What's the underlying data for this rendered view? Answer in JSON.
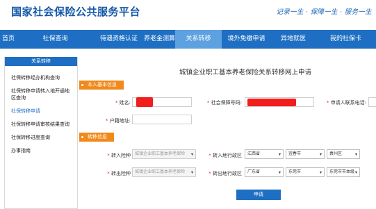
{
  "header": {
    "title": "国家社会保险公共服务平台",
    "slogan": "记录一生 · 保障一生 · 服务一生"
  },
  "nav": {
    "items": [
      {
        "label": "首页"
      },
      {
        "label": "社保查询"
      },
      {
        "label": "待遇资格认证"
      },
      {
        "label": "养老金测算"
      },
      {
        "label": "关系转移"
      },
      {
        "label": "境外免缴申请"
      },
      {
        "label": "异地就医"
      },
      {
        "label": "我的社保卡"
      }
    ],
    "active_index": 4
  },
  "sidebar": {
    "heading": "关系转移",
    "items": [
      {
        "label": "社保转移经办机构查询"
      },
      {
        "label": "社保转移申请转入地开通地区查询"
      },
      {
        "label": "社保转移申请"
      },
      {
        "label": "社保转移申请审核结果查询"
      },
      {
        "label": "社保转移进度查询"
      },
      {
        "label": "办事指南"
      }
    ],
    "active_index": 2
  },
  "form": {
    "title": "城镇企业职工基本养老保险关系转移网上申请",
    "section_basic": "本人基本信息",
    "name_label": "姓名:",
    "ss_number_label": "社会保障号码:",
    "phone_label": "申请人联系电话:",
    "household_label": "户籍地址:",
    "section_transfer": "转移信息",
    "transfer_in_type_label": "转入险种",
    "transfer_in_type_value": "城镇企业职工基本养老保险",
    "transfer_in_region_label": "转入地行政区",
    "transfer_in_province": "江西省",
    "transfer_in_city": "宜春市",
    "transfer_in_district": "袁州区",
    "transfer_out_type_label": "转出险种",
    "transfer_out_type_value": "城镇企业职工基本养老保险",
    "transfer_out_region_label": "转出地行政区",
    "transfer_out_province": "广东省",
    "transfer_out_city": "东莞市",
    "transfer_out_district": "东莞市市本级",
    "submit_label": "申请"
  },
  "colors": {
    "brand_blue": "#1e6fc3",
    "active_tab": "#5ea1e0",
    "section_orange": "#f08a1c",
    "redaction_red": "#f21d1d"
  }
}
